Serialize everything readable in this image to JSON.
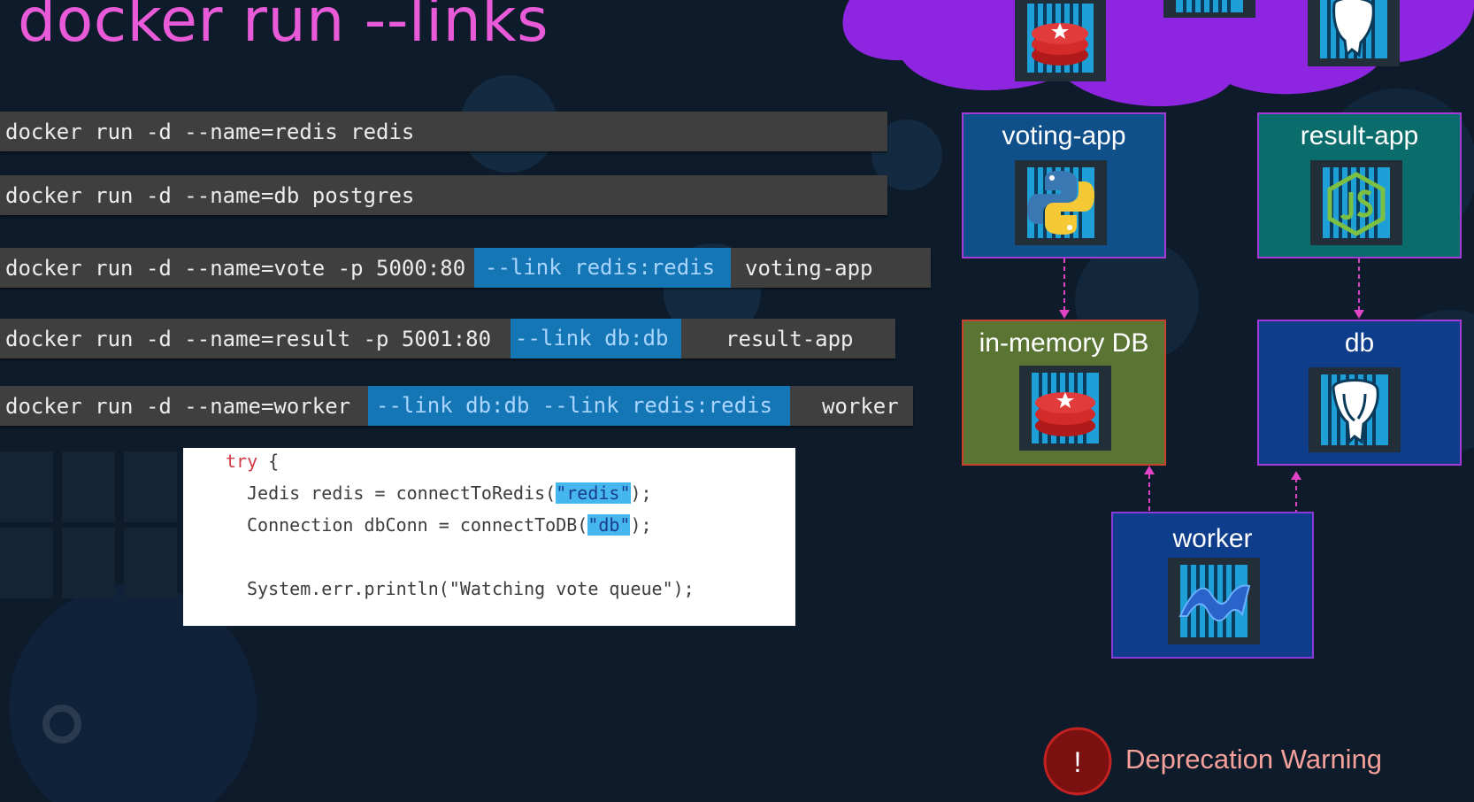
{
  "slide": {
    "title": "docker run --links"
  },
  "commands": [
    {
      "base": "docker run -d --name=redis redis"
    },
    {
      "base": "docker run -d --name=db postgres"
    },
    {
      "base": "docker run -d --name=vote -p 5000:80",
      "link": "--link redis:redis",
      "image": "voting-app"
    },
    {
      "base": "docker run -d --name=result -p 5001:80",
      "link": "--link db:db",
      "image": "result-app"
    },
    {
      "base": "docker run -d --name=worker",
      "link": "--link db:db --link redis:redis",
      "image": "worker"
    }
  ],
  "code_snippet": {
    "l1_kw": "try",
    "l1_rest": " {",
    "l2_pre": "Jedis redis = connectToRedis(",
    "l2_hl": "\"redis\"",
    "l2_post": ");",
    "l3_pre": "Connection dbConn = connectToDB(",
    "l3_hl": "\"db\"",
    "l3_post": ");",
    "l4": "System.err.println(\"Watching vote queue\");"
  },
  "diagram": {
    "nodes": {
      "voting_app": {
        "label": "voting-app",
        "color": "#0f4f8a",
        "icon": "python-icon"
      },
      "result_app": {
        "label": "result-app",
        "color": "#0a6d6b",
        "icon": "nodejs-icon"
      },
      "in_memory_db": {
        "label": "in-memory DB",
        "color": "#5a7434",
        "icon": "redis-icon"
      },
      "db": {
        "label": "db",
        "color": "#0e3d8c",
        "icon": "postgres-icon"
      },
      "worker": {
        "label": "worker",
        "color": "#0e3d8c",
        "icon": "dotnet-icon"
      }
    },
    "cloud_color": "#8e25e0",
    "arrow_color": "#e044c4"
  },
  "warning": {
    "symbol": "!",
    "text": "Deprecation Warning",
    "color": "#7a1010"
  },
  "colors": {
    "title": "#e85ad8",
    "background": "#0d1b2a",
    "command_bar": "#3f3f3f",
    "link_highlight": "#1576b5"
  }
}
